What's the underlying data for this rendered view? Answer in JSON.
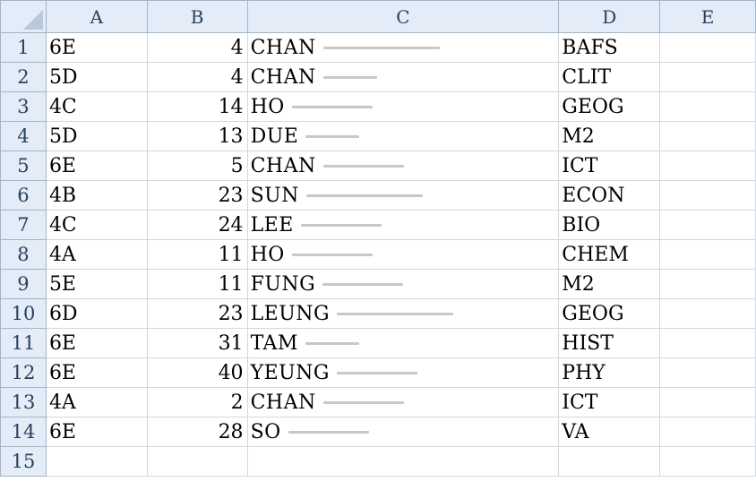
{
  "columns": [
    "A",
    "B",
    "C",
    "D",
    "E"
  ],
  "rows": [
    {
      "num": "1",
      "a": "6E",
      "b": "4",
      "c": "CHAN",
      "d": "BAFS"
    },
    {
      "num": "2",
      "a": "5D",
      "b": "4",
      "c": "CHAN",
      "d": "CLIT"
    },
    {
      "num": "3",
      "a": "4C",
      "b": "14",
      "c": "HO",
      "d": "GEOG"
    },
    {
      "num": "4",
      "a": "5D",
      "b": "13",
      "c": "DUE",
      "d": "M2"
    },
    {
      "num": "5",
      "a": "6E",
      "b": "5",
      "c": "CHAN",
      "d": "ICT"
    },
    {
      "num": "6",
      "a": "4B",
      "b": "23",
      "c": "SUN",
      "d": "ECON"
    },
    {
      "num": "7",
      "a": "4C",
      "b": "24",
      "c": "LEE",
      "d": "BIO"
    },
    {
      "num": "8",
      "a": "4A",
      "b": "11",
      "c": "HO",
      "d": "CHEM"
    },
    {
      "num": "9",
      "a": "5E",
      "b": "11",
      "c": "FUNG",
      "d": "M2"
    },
    {
      "num": "10",
      "a": "6D",
      "b": "23",
      "c": "LEUNG",
      "d": "GEOG"
    },
    {
      "num": "11",
      "a": "6E",
      "b": "31",
      "c": "TAM",
      "d": "HIST"
    },
    {
      "num": "12",
      "a": "6E",
      "b": "40",
      "c": "YEUNG",
      "d": "PHY"
    },
    {
      "num": "13",
      "a": "4A",
      "b": "2",
      "c": "CHAN",
      "d": "ICT"
    },
    {
      "num": "14",
      "a": "6E",
      "b": "28",
      "c": "SO",
      "d": "VA"
    },
    {
      "num": "15",
      "a": "",
      "b": "",
      "c": "",
      "d": ""
    }
  ]
}
